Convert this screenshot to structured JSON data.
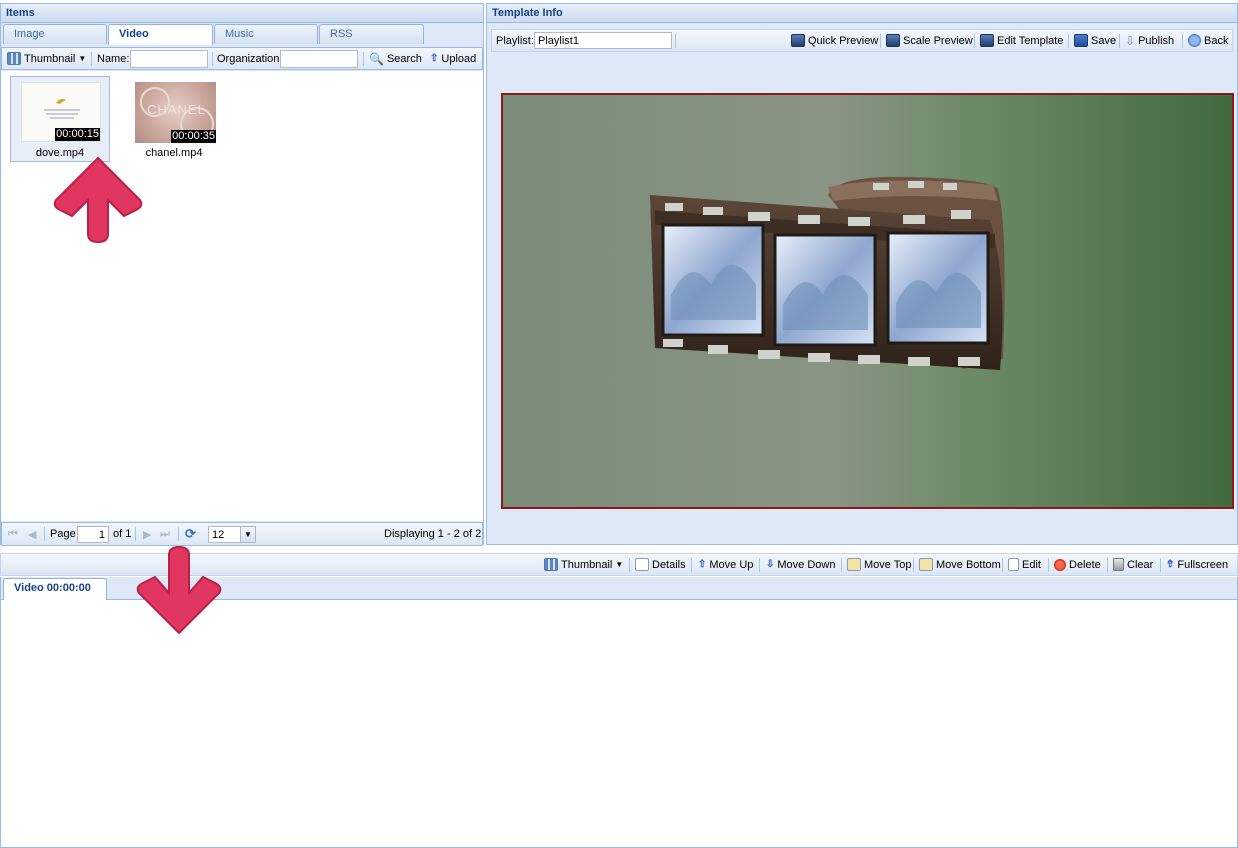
{
  "left": {
    "header": "Items",
    "tabs": [
      "Image",
      "Video",
      "Music",
      "RSS"
    ],
    "toolbar": {
      "view_label": "Thumbnail",
      "name_label": "Name:",
      "name_value": "",
      "org_label": "Organization:",
      "org_value": "",
      "search_label": "Search",
      "upload_label": "Upload"
    },
    "items": [
      {
        "name": "dove.mp4",
        "duration": "00:00:15",
        "thumb_text": "Can good eating also change your body language?"
      },
      {
        "name": "chanel.mp4",
        "duration": "00:00:35",
        "thumb_text": "CHANEL"
      }
    ],
    "pager": {
      "page_label": "Page",
      "page_value": "1",
      "of_label": "of 1",
      "per_page": "12",
      "display_text": "Displaying 1 - 2 of 2"
    }
  },
  "right": {
    "header": "Template Info",
    "playlist_label": "Playlist:",
    "playlist_value": "Playlist1",
    "toolbar": {
      "quick_preview": "Quick Preview",
      "scale_preview": "Scale Preview",
      "edit_template": "Edit Template",
      "save": "Save",
      "publish": "Publish",
      "back": "Back"
    }
  },
  "bottom": {
    "toolbar": {
      "thumbnail": "Thumbnail",
      "details": "Details",
      "move_up": "Move Up",
      "move_down": "Move Down",
      "move_top": "Move Top",
      "move_bottom": "Move Bottom",
      "edit": "Edit",
      "delete": "Delete",
      "clear": "Clear",
      "fullscreen": "Fullscreen"
    },
    "tab_label": "Video 00:00:00"
  },
  "colors": {
    "panel_border": "#99bbe8",
    "header_text": "#15428b",
    "annotation_arrow": "#e0365f",
    "preview_border": "#8b1a1a"
  },
  "icons": [
    "grid-icon",
    "search-icon",
    "upload-icon",
    "film-icon",
    "save-icon",
    "publish-icon",
    "back-icon",
    "refresh-icon",
    "details-icon",
    "delete-icon",
    "clear-icon",
    "fullscreen-icon"
  ]
}
